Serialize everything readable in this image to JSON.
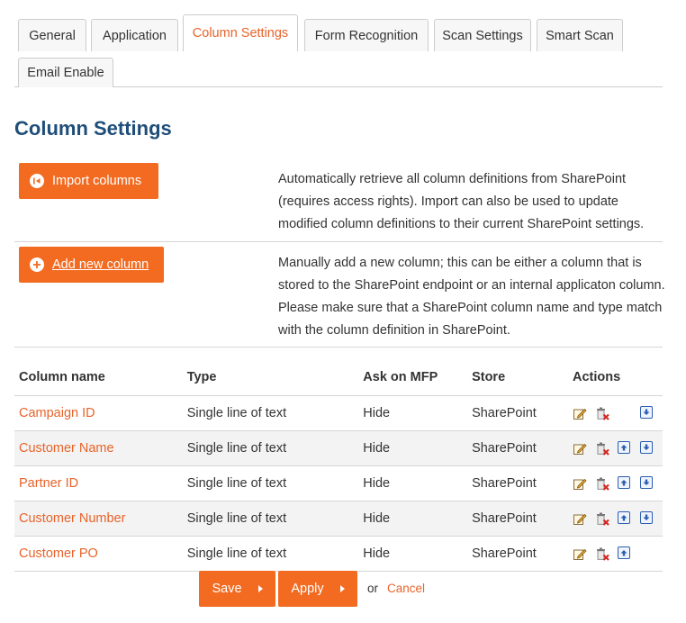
{
  "tabs": [
    {
      "label": "General"
    },
    {
      "label": "Application"
    },
    {
      "label": "Column Settings",
      "active": true
    },
    {
      "label": "Form Recognition"
    },
    {
      "label": "Scan Settings"
    },
    {
      "label": "Smart Scan"
    },
    {
      "label": "Email Enable"
    }
  ],
  "page": {
    "title": "Column Settings"
  },
  "import": {
    "button_label": "Import columns",
    "description": "Automatically retrieve all column definitions from SharePoint (requires access rights). Import can also be used to update modified column definitions to their current SharePoint settings."
  },
  "add": {
    "button_label": "Add new column",
    "description": "Manually add a new column; this can be either a column that is stored to the SharePoint endpoint or an internal applicaton column. Please make sure that a SharePoint column name and type match with the column definition in SharePoint."
  },
  "table": {
    "headers": {
      "name": "Column name",
      "type": "Type",
      "ask": "Ask on MFP",
      "store": "Store",
      "actions": "Actions"
    },
    "rows": [
      {
        "name": "Campaign ID",
        "type": "Single line of text",
        "ask": "Hide",
        "store": "SharePoint"
      },
      {
        "name": "Customer Name",
        "type": "Single line of text",
        "ask": "Hide",
        "store": "SharePoint"
      },
      {
        "name": "Partner ID",
        "type": "Single line of text",
        "ask": "Hide",
        "store": "SharePoint"
      },
      {
        "name": "Customer Number",
        "type": "Single line of text",
        "ask": "Hide",
        "store": "SharePoint"
      },
      {
        "name": "Customer PO",
        "type": "Single line of text",
        "ask": "Hide",
        "store": "SharePoint"
      }
    ]
  },
  "footer": {
    "save_label": "Save",
    "apply_label": "Apply",
    "or_text": "or",
    "cancel_label": "Cancel"
  },
  "colors": {
    "accent": "#f26b21",
    "link": "#e8632a",
    "title": "#1f4e79"
  }
}
